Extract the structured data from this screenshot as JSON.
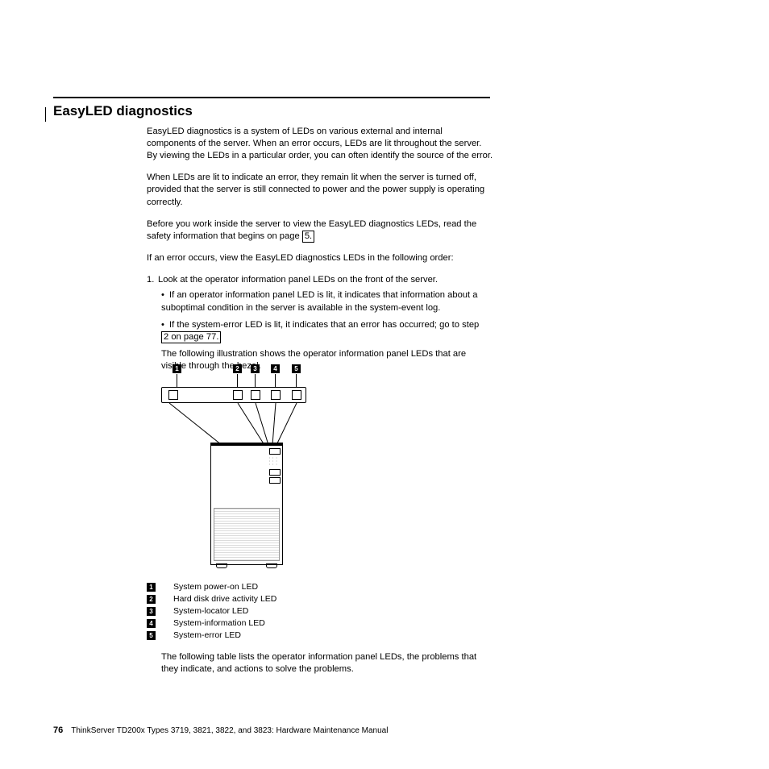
{
  "heading": "EasyLED diagnostics",
  "para1": "EasyLED diagnostics is a system of LEDs on various external and internal components of the server. When an error occurs, LEDs are lit throughout the server. By viewing the LEDs in a particular order, you can often identify the source of the error.",
  "para2": "When LEDs are lit to indicate an error, they remain lit when the server is turned off, provided that the server is still connected to power and the power supply is operating correctly.",
  "para3a": "Before you work inside the server to view the EasyLED diagnostics LEDs, read the safety information that begins on page ",
  "para3link": "5.",
  "para4": "If an error occurs, view the EasyLED diagnostics LEDs in the following order:",
  "step1_num": "1.",
  "step1_text": "Look at the operator information panel LEDs on the front of the server.",
  "bullet1": "If an operator information panel LED is lit, it indicates that information about a suboptimal condition in the server is available in the system-event log.",
  "bullet2a": "If the system-error LED is lit, it indicates that an error has occurred; go to step ",
  "bullet2link": "2 on page 77.",
  "after": "The following illustration shows the operator information panel LEDs that are visible through the bezel.",
  "callouts": [
    "1",
    "2",
    "3",
    "4",
    "5"
  ],
  "legend": [
    {
      "n": "1",
      "t": "System power-on LED"
    },
    {
      "n": "2",
      "t": "Hard disk drive activity LED"
    },
    {
      "n": "3",
      "t": "System-locator LED"
    },
    {
      "n": "4",
      "t": "System-information LED"
    },
    {
      "n": "5",
      "t": "System-error LED"
    }
  ],
  "closing": "The following table lists the operator information panel LEDs, the problems that they indicate, and actions to solve the problems.",
  "page_num": "76",
  "footer": "ThinkServer TD200x Types 3719, 3821, 3822, and 3823: Hardware Maintenance Manual"
}
